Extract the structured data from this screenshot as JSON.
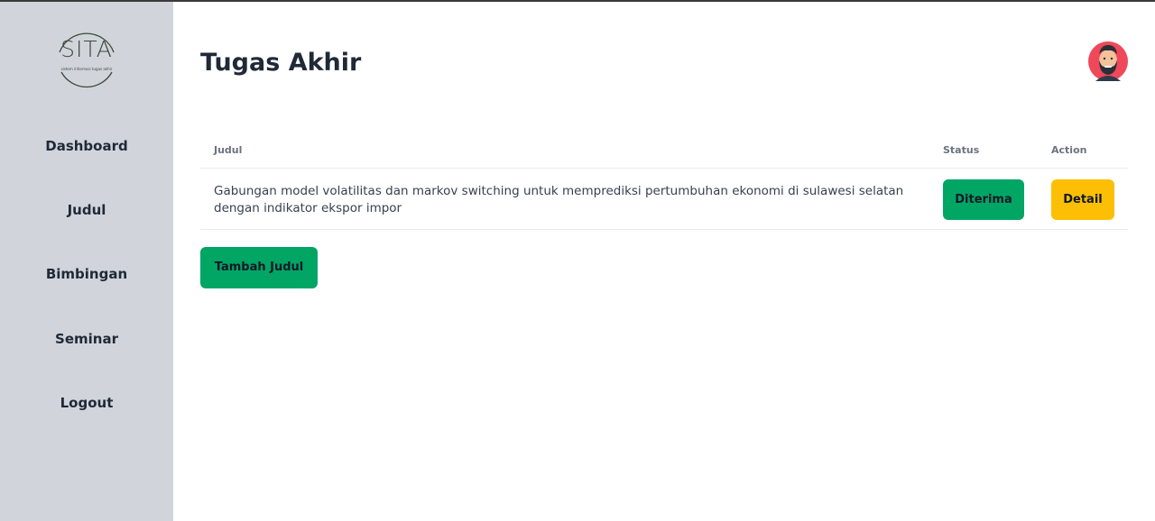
{
  "sidebar": {
    "logo": {
      "title": "SITA",
      "subtitle": "sistem informasi tugas akhir"
    },
    "items": [
      {
        "label": "Dashboard"
      },
      {
        "label": "Judul"
      },
      {
        "label": "Bimbingan"
      },
      {
        "label": "Seminar"
      },
      {
        "label": "Logout"
      }
    ]
  },
  "header": {
    "title": "Tugas Akhir",
    "avatar_icon": "bearded-man-avatar-icon"
  },
  "table": {
    "columns": [
      "Judul",
      "Status",
      "Action"
    ],
    "rows": [
      {
        "judul": "Gabungan model volatilitas dan markov switching untuk memprediksi pertumbuhan ekonomi di sulawesi selatan dengan indikator ekspor impor",
        "status": "Diterima",
        "action": "Detail"
      }
    ]
  },
  "actions": {
    "add_label": "Tambah Judul"
  },
  "colors": {
    "sidebar_bg": "#d1d5db",
    "status_green": "#01a564",
    "detail_yellow": "#fdbf05",
    "avatar_bg": "#f0485b"
  }
}
